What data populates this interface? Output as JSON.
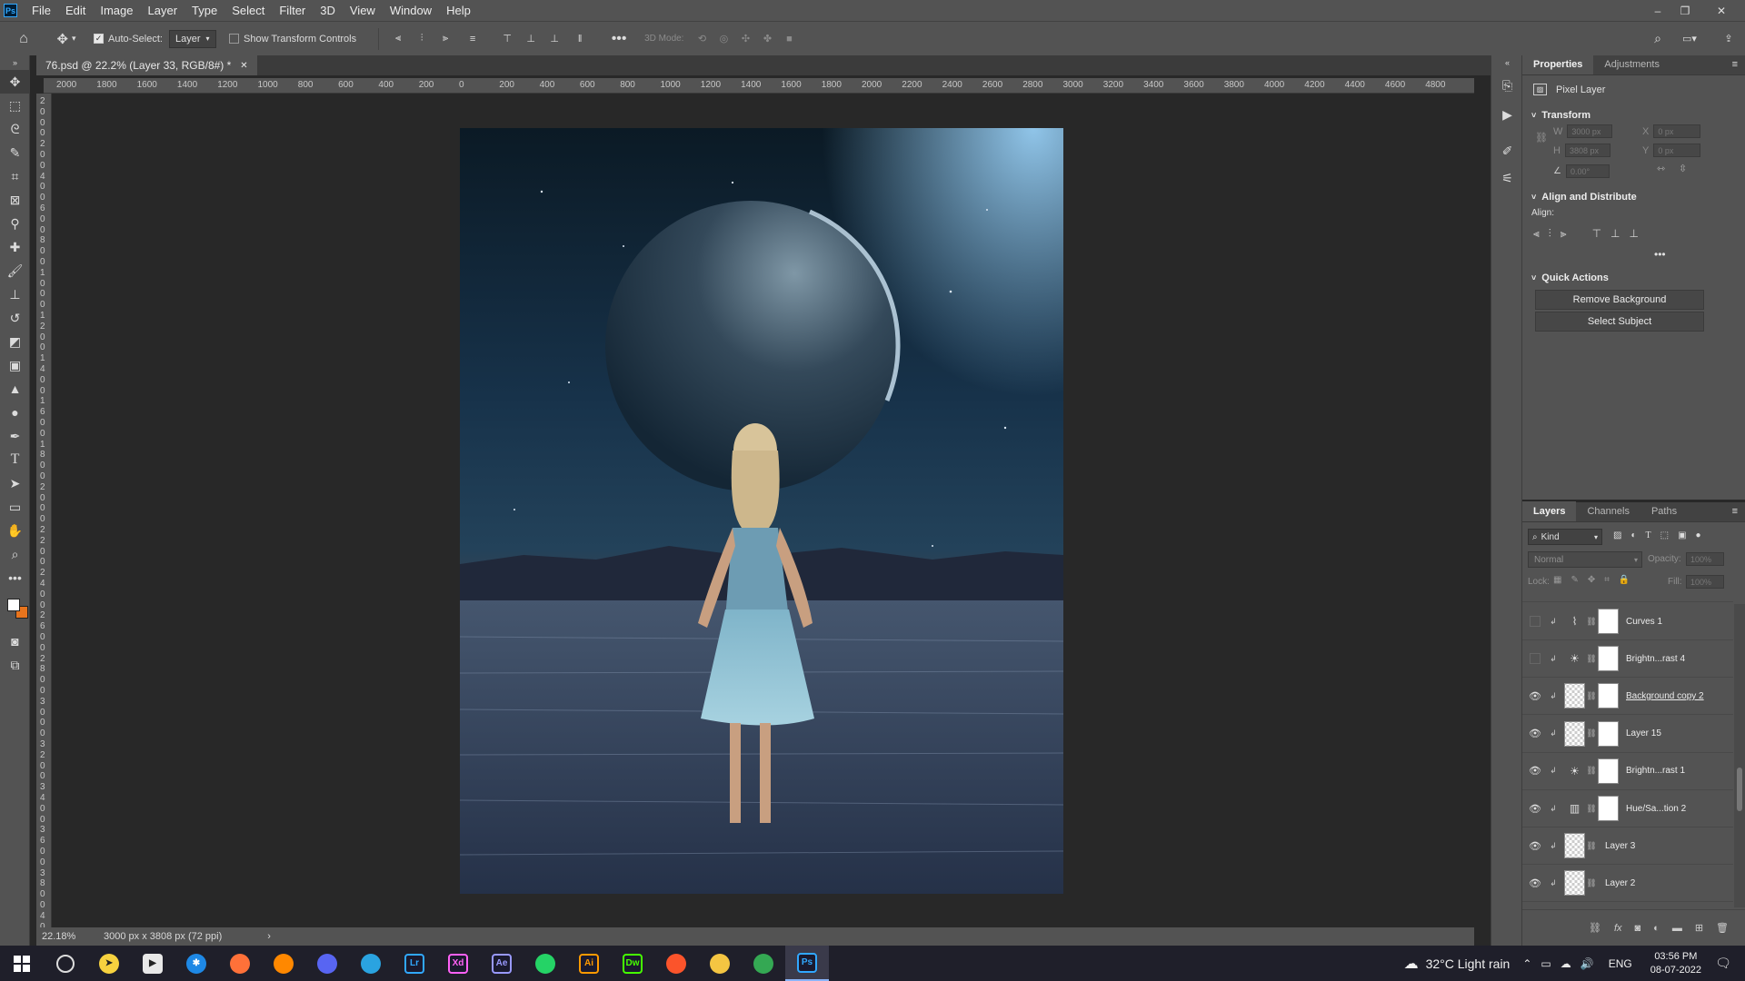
{
  "app": {
    "logo": "Ps"
  },
  "menu": [
    "File",
    "Edit",
    "Image",
    "Layer",
    "Type",
    "Select",
    "Filter",
    "3D",
    "View",
    "Window",
    "Help"
  ],
  "options": {
    "auto_select_label": "Auto-Select:",
    "auto_select_value": "Layer",
    "transform_label": "Show Transform Controls",
    "mode_label": "3D Mode:"
  },
  "document": {
    "tab_title": "76.psd @ 22.2% (Layer 33, RGB/8#) *",
    "zoom": "22.18%",
    "dimensions": "3000 px x 3808 px (72 ppi)"
  },
  "ruler": {
    "h_labels": [
      "2000",
      "1800",
      "1600",
      "1400",
      "1200",
      "1000",
      "800",
      "600",
      "400",
      "200",
      "0",
      "200",
      "400",
      "600",
      "800",
      "1000",
      "1200",
      "1400",
      "1600",
      "1800",
      "2000",
      "2200",
      "2400",
      "2600",
      "2800",
      "3000",
      "3200",
      "3400",
      "3600",
      "3800",
      "4000",
      "4200",
      "4400",
      "4600",
      "4800"
    ],
    "v_labels": [
      "2",
      "0",
      "0",
      "0",
      "2",
      "0",
      "0",
      "4",
      "0",
      "0",
      "6",
      "0",
      "0",
      "8",
      "0",
      "0",
      "1",
      "0",
      "0",
      "0",
      "1",
      "2",
      "0",
      "0",
      "1",
      "4",
      "0",
      "0",
      "1",
      "6",
      "0",
      "0",
      "1",
      "8",
      "0",
      "0",
      "2",
      "0",
      "0",
      "0",
      "2",
      "2",
      "0",
      "0",
      "2",
      "4",
      "0",
      "0",
      "2",
      "6",
      "0",
      "0",
      "2",
      "8",
      "0",
      "0",
      "3",
      "0",
      "0",
      "0",
      "3",
      "2",
      "0",
      "0",
      "3",
      "4",
      "0",
      "0",
      "3",
      "6",
      "0",
      "0",
      "3",
      "8",
      "0",
      "0",
      "4",
      "0"
    ]
  },
  "properties": {
    "tab_properties": "Properties",
    "tab_adjustments": "Adjustments",
    "layer_type": "Pixel Layer",
    "transform_title": "Transform",
    "w_label": "W",
    "w_value": "3000 px",
    "h_label": "H",
    "h_value": "3808 px",
    "x_label": "X",
    "x_value": "0 px",
    "y_label": "Y",
    "y_value": "0 px",
    "angle_value": "0.00°",
    "align_title": "Align and Distribute",
    "align_label": "Align:",
    "quick_title": "Quick Actions",
    "remove_bg": "Remove Background",
    "select_subject": "Select Subject"
  },
  "layers_panel": {
    "tab_layers": "Layers",
    "tab_channels": "Channels",
    "tab_paths": "Paths",
    "kind_label": "Kind",
    "blend_mode": "Normal",
    "opacity_label": "Opacity:",
    "opacity_value": "100%",
    "lock_label": "Lock:",
    "fill_label": "Fill:",
    "fill_value": "100%",
    "layers": [
      {
        "name": "Curves 1",
        "visible": false,
        "icon": "curves-icon"
      },
      {
        "name": "Brightn...rast 4",
        "visible": false,
        "icon": "brightness-icon"
      },
      {
        "name": "Background copy 2",
        "visible": true,
        "icon": "pixel-icon"
      },
      {
        "name": "Layer 15",
        "visible": true,
        "icon": "pixel-icon"
      },
      {
        "name": "Brightn...rast 1",
        "visible": true,
        "icon": "brightness-icon"
      },
      {
        "name": "Hue/Sa...tion 2",
        "visible": true,
        "icon": "hue-icon"
      },
      {
        "name": "Layer 3",
        "visible": true,
        "icon": "pixel-icon"
      },
      {
        "name": "Layer 2",
        "visible": true,
        "icon": "pixel-icon"
      }
    ]
  },
  "taskbar": {
    "apps": [
      {
        "name": "firefox",
        "label": "",
        "color": "#ff7139"
      },
      {
        "name": "vlc",
        "label": "",
        "color": "#ff8800"
      },
      {
        "name": "discord",
        "label": "",
        "color": "#5865f2"
      },
      {
        "name": "telegram",
        "label": "",
        "color": "#2aa3e0"
      },
      {
        "name": "lightroom",
        "label": "Lr",
        "color": "#31a8ff"
      },
      {
        "name": "xd",
        "label": "Xd",
        "color": "#ff61f6"
      },
      {
        "name": "after-effects",
        "label": "Ae",
        "color": "#9999ff"
      },
      {
        "name": "whatsapp",
        "label": "",
        "color": "#25d366"
      },
      {
        "name": "illustrator",
        "label": "Ai",
        "color": "#ff9a00"
      },
      {
        "name": "dreamweaver",
        "label": "Dw",
        "color": "#46ff00"
      },
      {
        "name": "brave",
        "label": "",
        "color": "#fb542b"
      },
      {
        "name": "file-explorer",
        "label": "",
        "color": "#f4c542"
      },
      {
        "name": "chrome",
        "label": "",
        "color": "#34a853"
      },
      {
        "name": "photoshop",
        "label": "Ps",
        "color": "#31a8ff"
      }
    ],
    "weather": "32°C  Light rain",
    "language": "ENG",
    "time": "03:56 PM",
    "date": "08-07-2022"
  }
}
